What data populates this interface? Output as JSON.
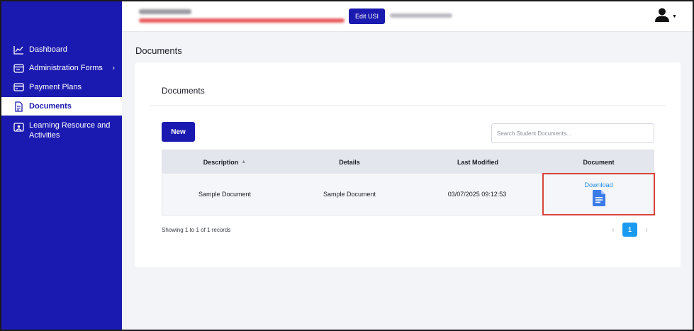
{
  "sidebar": {
    "items": [
      {
        "label": "Dashboard",
        "icon": "chart-line-icon"
      },
      {
        "label": "Administration Forms",
        "icon": "forms-icon"
      },
      {
        "label": "Payment Plans",
        "icon": "credit-card-icon"
      },
      {
        "label": "Documents",
        "icon": "document-icon"
      },
      {
        "label": "Learning Resource and Activities",
        "icon": "presentation-icon"
      }
    ]
  },
  "header": {
    "edit_usi_label": "Edit USI"
  },
  "page": {
    "title": "Documents"
  },
  "card": {
    "title": "Documents",
    "new_button": "New",
    "search_placeholder": "Search Student Documents..."
  },
  "table": {
    "columns": [
      "Description",
      "Details",
      "Last Modified",
      "Document"
    ],
    "rows": [
      {
        "description": "Sample Document",
        "details": "Sample Document",
        "last_modified": "03/07/2025 09:12:53",
        "document_link": "Download"
      }
    ]
  },
  "footer": {
    "records_text": "Showing 1 to 1 of 1 records",
    "current_page": "1"
  },
  "colors": {
    "brand": "#1b1ab0",
    "accent": "#1a9bf0",
    "highlight_border": "#d9433b",
    "doc_icon": "#3b7be8"
  }
}
